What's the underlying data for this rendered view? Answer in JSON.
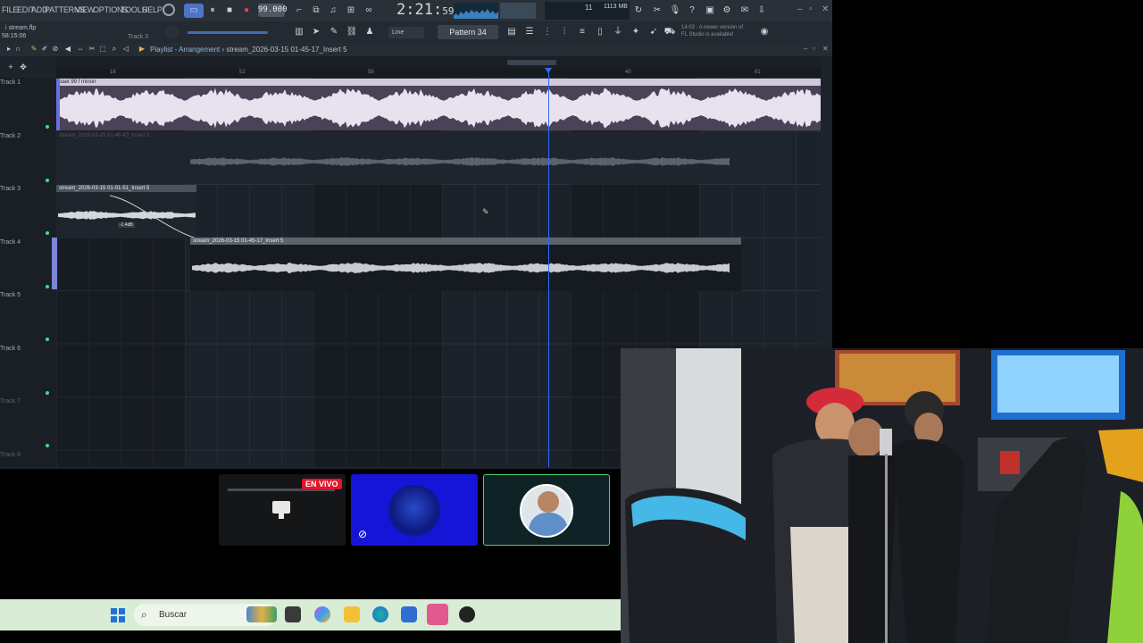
{
  "fl_window": {
    "menu": [
      "FILE",
      "EDIT",
      "ADD",
      "PATTERNS",
      "VIEW",
      "OPTIONS",
      "TOOLS",
      "HELP"
    ],
    "tempo": "99.000",
    "time_main": "2:21",
    "time_sub": "59",
    "cpu": "11",
    "memory": "1113 MB",
    "song_name": "i stream.flp",
    "song_time": "58:15:06",
    "track_hint": "Track 3",
    "snap": "Line",
    "pattern": "Pattern 34",
    "news_line1": "14:03 : A newer version of",
    "news_line2": "FL Studio is available!",
    "playlist_title": "Playlist - Arrangement",
    "playlist_sep": "›",
    "playlist_path": "stream_2026-03-15 01-45-17_Insert 5",
    "ruler": [
      "16",
      "52",
      "58",
      "40",
      "61"
    ],
    "tracks": [
      "Track 1",
      "Track 2",
      "Track 3",
      "Track 4",
      "Track 5",
      "Track 6",
      "Track 7",
      "Track 8"
    ],
    "clips": {
      "c1": "baet 99 f minorr",
      "c2": "stream_2026-03-15 01-46-43_Insert 5",
      "c3": "stream_2026-03-15 01-01-51_Insert 5",
      "c4": "stream_2026-03-15 01-45-17_Insert 5"
    },
    "fade_value": "-1.4dB"
  },
  "overlay": {
    "live_badge": "EN VIVO"
  },
  "taskbar": {
    "search_placeholder": "Buscar"
  },
  "colors": {
    "fl_bg": "#1d232a",
    "playhead": "#2f6bff",
    "clip_main": "#b6a9c6",
    "live_red": "#e3152a",
    "taskbar": "#d9ecd6"
  }
}
